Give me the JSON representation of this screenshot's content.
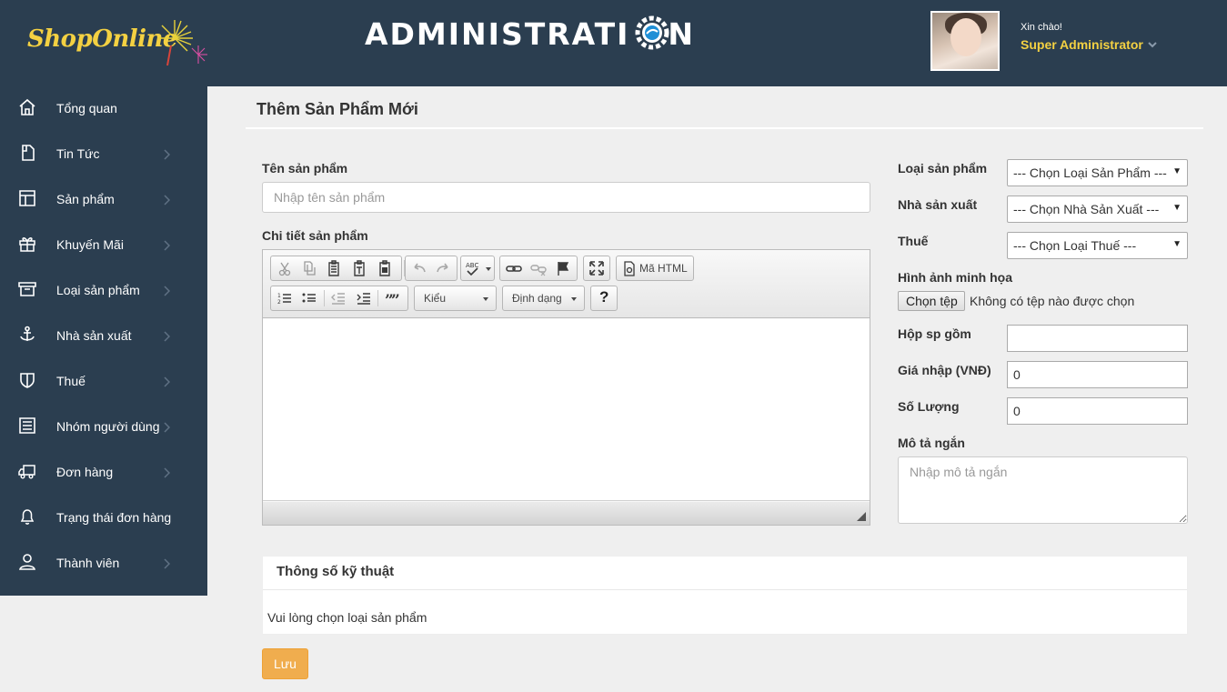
{
  "header": {
    "logo_text": "ShopOnline",
    "title": "ADMINISTRATI",
    "title_end": "N",
    "greeting": "Xin chào!",
    "user_name": "Super Administrator"
  },
  "sidebar": {
    "items": [
      {
        "label": "Tổng quan",
        "icon": "home-icon",
        "has_submenu": false
      },
      {
        "label": "Tin Tức",
        "icon": "document-icon",
        "has_submenu": true
      },
      {
        "label": "Sản phẩm",
        "icon": "layout-icon",
        "has_submenu": true
      },
      {
        "label": "Khuyến Mãi",
        "icon": "gift-icon",
        "has_submenu": true
      },
      {
        "label": "Loại sản phẩm",
        "icon": "archive-icon",
        "has_submenu": true
      },
      {
        "label": "Nhà sản xuất",
        "icon": "anchor-icon",
        "has_submenu": true
      },
      {
        "label": "Thuế",
        "icon": "shield-icon",
        "has_submenu": true
      },
      {
        "label": "Nhóm người dùng",
        "icon": "list-icon",
        "has_submenu": true
      },
      {
        "label": "Đơn hàng",
        "icon": "truck-icon",
        "has_submenu": true
      },
      {
        "label": "Trạng thái đơn hàng",
        "icon": "bell-icon",
        "has_submenu": false
      },
      {
        "label": "Thành viên",
        "icon": "user-icon",
        "has_submenu": true
      }
    ]
  },
  "page": {
    "title": "Thêm Sản Phẩm Mới"
  },
  "form": {
    "name_label": "Tên sản phẩm",
    "name_placeholder": "Nhập tên sản phẩm",
    "detail_label": "Chi tiết sản phẩm",
    "editor": {
      "source_label": "Mã HTML",
      "style_combo": "Kiểu",
      "format_combo": "Định dạng",
      "help_label": "?"
    },
    "category_label": "Loại sản phẩm",
    "category_value": "--- Chọn Loại Sản Phẩm ---",
    "maker_label": "Nhà sản xuất",
    "maker_value": "--- Chọn Nhà Sản Xuất ---",
    "tax_label": "Thuế",
    "tax_value": "--- Chọn Loại Thuế ---",
    "image_label": "Hình ảnh minh họa",
    "file_button": "Chọn tệp",
    "file_status": "Không có tệp nào được chọn",
    "box_label": "Hộp sp gồm",
    "box_value": "",
    "price_label": "Giá nhập (VNĐ)",
    "price_value": "0",
    "qty_label": "Số Lượng",
    "qty_value": "0",
    "short_desc_label": "Mô tả ngắn",
    "short_desc_placeholder": "Nhập mô tả ngắn"
  },
  "specs": {
    "title": "Thông số kỹ thuật",
    "message": "Vui lòng chọn loại sản phẩm"
  },
  "actions": {
    "save_label": "Lưu"
  },
  "colors": {
    "header_bg": "#2b3e50",
    "accent_yellow": "#f4d142",
    "save_button": "#f0ad4e",
    "page_bg": "#efefef"
  }
}
